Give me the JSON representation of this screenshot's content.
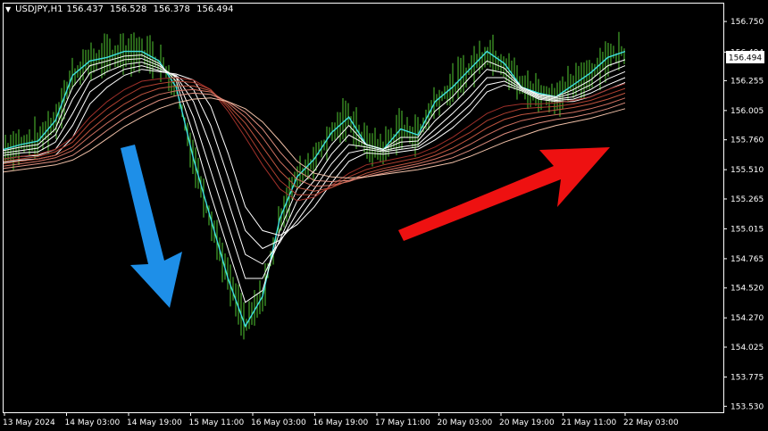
{
  "header": {
    "symbol": "USDJPY,H1",
    "open": "156.437",
    "high": "156.528",
    "low": "156.378",
    "close": "156.494"
  },
  "price_tag": "156.494",
  "colors": {
    "background": "#000000",
    "axes": "#ffffff",
    "bars": "#52c832",
    "fast_ma": "#ffffff",
    "top_ma": "#40e0e0",
    "slow_ma": [
      "#a0302a",
      "#b04030",
      "#c05540",
      "#d07060",
      "#e09080",
      "#f0c0a8"
    ],
    "down_arrow": "#1e8fe8",
    "up_arrow": "#ee1111"
  },
  "chart_data": {
    "type": "line",
    "title": "",
    "xlabel": "",
    "ylabel": "",
    "ylim": [
      153.48,
      156.9
    ],
    "y_ticks": [
      "156.750",
      "156.494",
      "156.255",
      "156.005",
      "155.760",
      "155.510",
      "155.265",
      "155.015",
      "154.765",
      "154.520",
      "154.270",
      "154.025",
      "153.775",
      "153.530"
    ],
    "x_ticks": [
      "13 May 2024",
      "14 May 03:00",
      "14 May 19:00",
      "15 May 11:00",
      "16 May 03:00",
      "16 May 19:00",
      "17 May 11:00",
      "20 May 03:00",
      "20 May 19:00",
      "21 May 11:00",
      "22 May 03:00"
    ],
    "grid": false,
    "series": [
      {
        "values": [
          155.68,
          155.72,
          155.75,
          155.92,
          156.3,
          156.42,
          156.45,
          156.5,
          156.5,
          156.42,
          156.2,
          155.6,
          155.1,
          154.6,
          154.2,
          154.45,
          155.1,
          155.45,
          155.6,
          155.82,
          155.95,
          155.72,
          155.68,
          155.85,
          155.8,
          156.08,
          156.2,
          156.35,
          156.5,
          156.4,
          156.2,
          156.15,
          156.12,
          156.22,
          156.32,
          156.45,
          156.5
        ]
      },
      {
        "values": [
          155.67,
          155.7,
          155.72,
          155.85,
          156.2,
          156.38,
          156.42,
          156.46,
          156.47,
          156.4,
          156.25,
          155.8,
          155.3,
          154.85,
          154.4,
          154.5,
          155.0,
          155.35,
          155.5,
          155.72,
          155.88,
          155.72,
          155.68,
          155.78,
          155.78,
          156.0,
          156.12,
          156.28,
          156.42,
          156.36,
          156.2,
          156.14,
          156.12,
          156.18,
          156.26,
          156.38,
          156.43
        ]
      },
      {
        "values": [
          155.65,
          155.67,
          155.69,
          155.8,
          156.1,
          156.32,
          156.38,
          156.43,
          156.44,
          156.38,
          156.28,
          155.95,
          155.5,
          155.05,
          154.6,
          154.6,
          154.92,
          155.25,
          155.42,
          155.64,
          155.8,
          155.72,
          155.68,
          155.74,
          155.75,
          155.92,
          156.05,
          156.2,
          156.35,
          156.32,
          156.2,
          156.13,
          156.11,
          156.15,
          156.22,
          156.32,
          156.38
        ]
      },
      {
        "values": [
          155.63,
          155.65,
          155.66,
          155.74,
          155.98,
          156.25,
          156.33,
          156.39,
          156.41,
          156.36,
          156.29,
          156.08,
          155.7,
          155.25,
          154.8,
          154.72,
          154.9,
          155.15,
          155.35,
          155.56,
          155.72,
          155.7,
          155.67,
          155.7,
          155.72,
          155.85,
          155.98,
          156.12,
          156.28,
          156.28,
          156.19,
          156.12,
          156.1,
          156.12,
          156.18,
          156.27,
          156.33
        ]
      },
      {
        "values": [
          155.6,
          155.62,
          155.63,
          155.68,
          155.88,
          156.16,
          156.27,
          156.35,
          156.38,
          156.34,
          156.3,
          156.18,
          155.88,
          155.45,
          155.0,
          154.85,
          154.92,
          155.08,
          155.28,
          155.48,
          155.65,
          155.68,
          155.66,
          155.68,
          155.7,
          155.8,
          155.92,
          156.05,
          156.22,
          156.25,
          156.18,
          156.11,
          156.09,
          156.1,
          156.15,
          156.22,
          156.28
        ]
      },
      {
        "values": [
          155.57,
          155.59,
          155.6,
          155.63,
          155.78,
          156.06,
          156.2,
          156.3,
          156.35,
          156.33,
          156.31,
          156.26,
          156.04,
          155.65,
          155.2,
          155.0,
          154.96,
          155.05,
          155.2,
          155.4,
          155.58,
          155.65,
          155.64,
          155.66,
          155.68,
          155.76,
          155.86,
          155.99,
          156.16,
          156.22,
          156.17,
          156.1,
          156.08,
          156.08,
          156.12,
          156.18,
          156.24
        ]
      },
      {
        "values": [
          155.6,
          155.62,
          155.64,
          155.68,
          155.78,
          155.95,
          156.08,
          156.18,
          156.25,
          156.27,
          156.28,
          156.26,
          156.18,
          156.0,
          155.78,
          155.55,
          155.35,
          155.25,
          155.28,
          155.38,
          155.48,
          155.55,
          155.58,
          155.61,
          155.64,
          155.7,
          155.78,
          155.88,
          155.98,
          156.04,
          156.06,
          156.06,
          156.07,
          156.09,
          156.12,
          156.18,
          156.23
        ]
      },
      {
        "values": [
          155.58,
          155.6,
          155.62,
          155.66,
          155.74,
          155.9,
          156.02,
          156.12,
          156.2,
          156.23,
          156.25,
          156.24,
          156.18,
          156.03,
          155.84,
          155.62,
          155.42,
          155.3,
          155.3,
          155.36,
          155.45,
          155.51,
          155.55,
          155.58,
          155.61,
          155.66,
          155.74,
          155.82,
          155.92,
          155.98,
          156.02,
          156.03,
          156.04,
          156.06,
          156.09,
          156.14,
          156.19
        ]
      },
      {
        "values": [
          155.56,
          155.58,
          155.6,
          155.63,
          155.7,
          155.84,
          155.96,
          156.06,
          156.14,
          156.19,
          156.21,
          156.21,
          156.17,
          156.05,
          155.9,
          155.7,
          155.5,
          155.36,
          155.33,
          155.36,
          155.42,
          155.48,
          155.52,
          155.55,
          155.58,
          155.63,
          155.69,
          155.77,
          155.86,
          155.93,
          155.97,
          155.99,
          156.01,
          156.03,
          156.06,
          156.1,
          156.15
        ]
      },
      {
        "values": [
          155.54,
          155.56,
          155.58,
          155.61,
          155.67,
          155.79,
          155.9,
          156.0,
          156.08,
          156.14,
          156.17,
          156.18,
          156.16,
          156.07,
          155.95,
          155.78,
          155.58,
          155.43,
          155.37,
          155.38,
          155.41,
          155.46,
          155.5,
          155.53,
          155.56,
          155.6,
          155.65,
          155.72,
          155.8,
          155.87,
          155.92,
          155.95,
          155.97,
          155.99,
          156.02,
          156.06,
          156.11
        ]
      },
      {
        "values": [
          155.52,
          155.54,
          155.56,
          155.58,
          155.63,
          155.73,
          155.84,
          155.94,
          156.02,
          156.09,
          156.13,
          156.15,
          156.14,
          156.08,
          155.99,
          155.85,
          155.66,
          155.5,
          155.42,
          155.41,
          155.42,
          155.45,
          155.48,
          155.51,
          155.54,
          155.57,
          155.61,
          155.67,
          155.74,
          155.81,
          155.86,
          155.9,
          155.93,
          155.95,
          155.98,
          156.02,
          156.07
        ]
      },
      {
        "values": [
          155.49,
          155.51,
          155.53,
          155.55,
          155.59,
          155.67,
          155.77,
          155.87,
          155.95,
          156.02,
          156.07,
          156.1,
          156.11,
          156.08,
          156.02,
          155.91,
          155.75,
          155.58,
          155.48,
          155.45,
          155.44,
          155.45,
          155.47,
          155.49,
          155.51,
          155.54,
          155.57,
          155.62,
          155.68,
          155.74,
          155.79,
          155.84,
          155.88,
          155.91,
          155.94,
          155.98,
          156.02
        ]
      }
    ]
  }
}
